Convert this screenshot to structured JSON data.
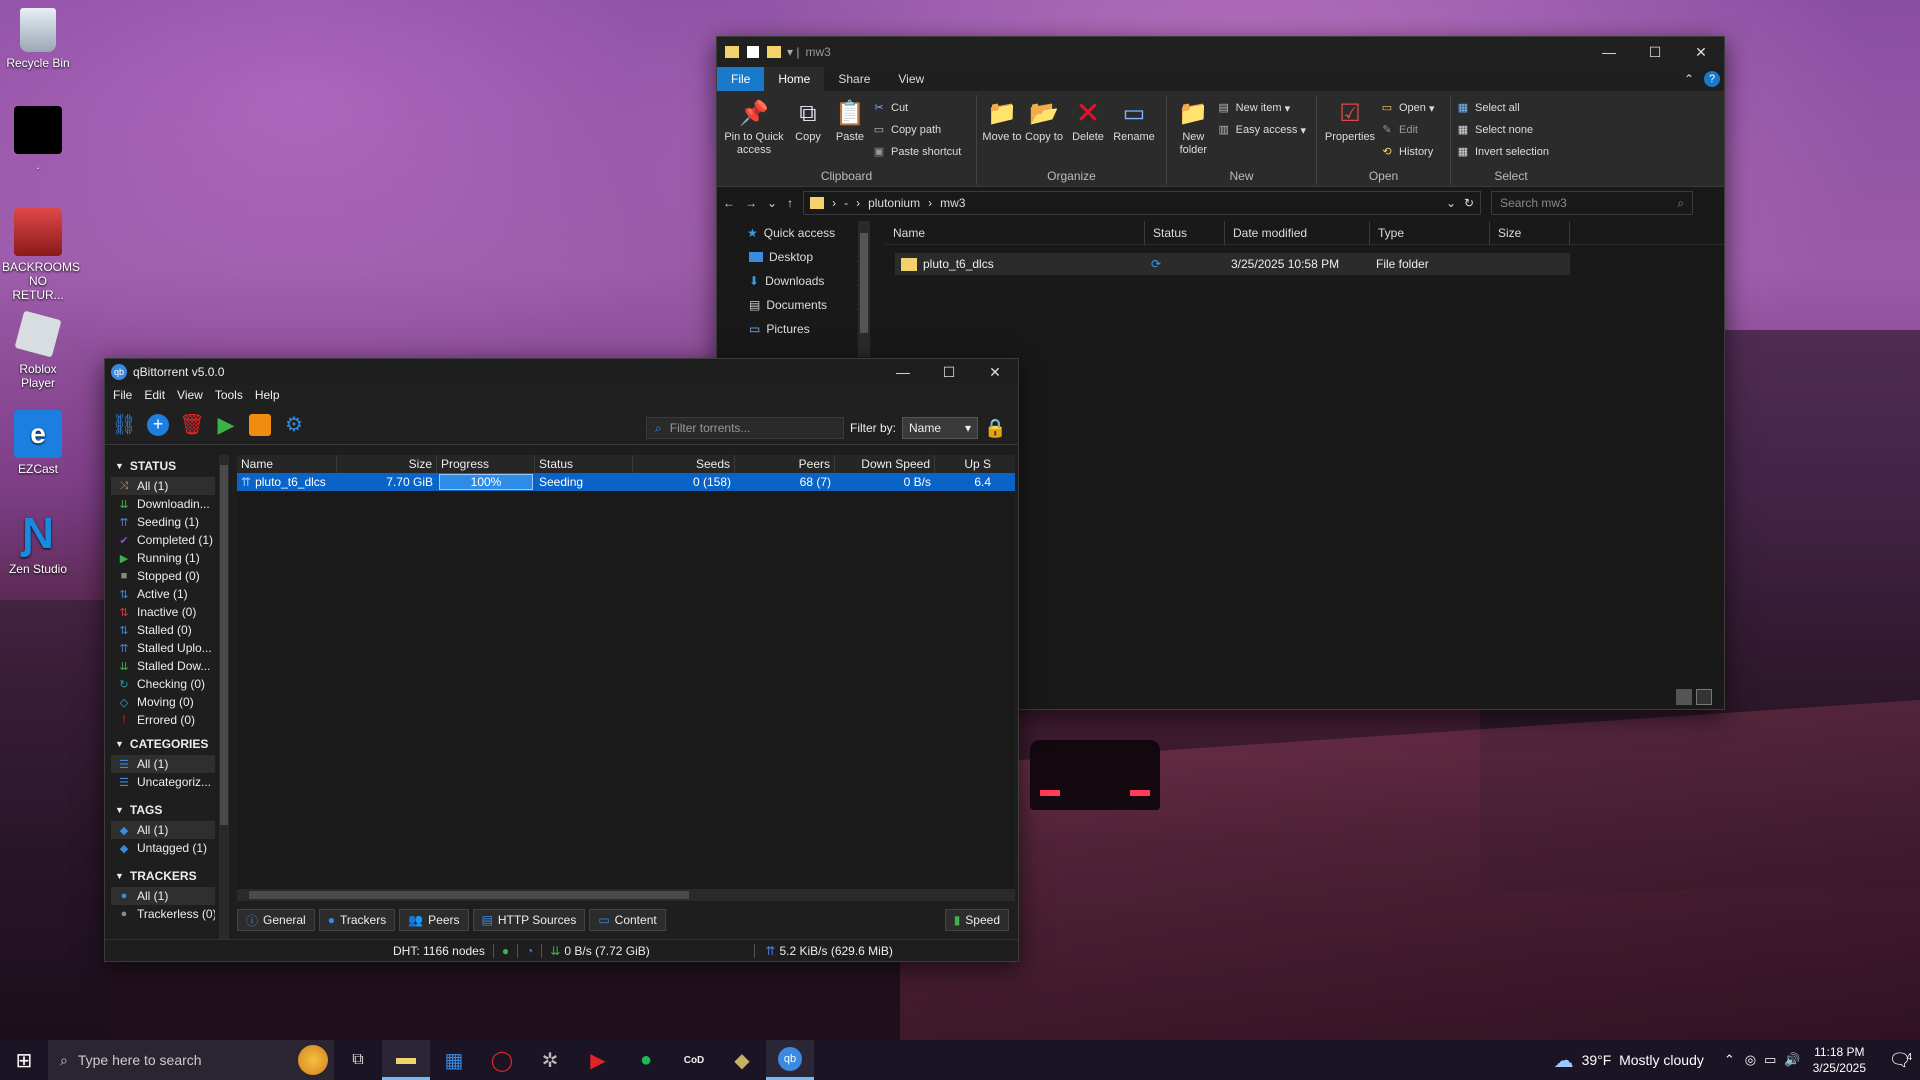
{
  "desktop": {
    "icons": [
      {
        "label": "Recycle Bin"
      },
      {
        "label": "."
      },
      {
        "label": "BACKROOMS NO RETUR..."
      },
      {
        "label": "Roblox Player"
      },
      {
        "label": "EZCast"
      },
      {
        "label": "Zen Studio"
      }
    ]
  },
  "explorer": {
    "title": "mw3",
    "tabs": {
      "file": "File",
      "home": "Home",
      "share": "Share",
      "view": "View"
    },
    "clipboard": {
      "pin": "Pin to Quick access",
      "copy": "Copy",
      "paste": "Paste",
      "cut": "Cut",
      "copy_path": "Copy path",
      "paste_shortcut": "Paste shortcut",
      "label": "Clipboard"
    },
    "organize": {
      "move": "Move to",
      "copy": "Copy to",
      "delete": "Delete",
      "rename": "Rename",
      "label": "Organize"
    },
    "new": {
      "folder": "New folder",
      "item": "New item",
      "easy": "Easy access",
      "label": "New"
    },
    "open": {
      "properties": "Properties",
      "open": "Open",
      "edit": "Edit",
      "history": "History",
      "label": "Open"
    },
    "select": {
      "all": "Select all",
      "none": "Select none",
      "invert": "Invert selection",
      "label": "Select"
    },
    "path": [
      "plutonium",
      "mw3"
    ],
    "search_placeholder": "Search mw3",
    "nav": [
      "Quick access",
      "Desktop",
      "Downloads",
      "Documents",
      "Pictures"
    ],
    "columns": [
      "Name",
      "Status",
      "Date modified",
      "Type",
      "Size"
    ],
    "rows": [
      {
        "name": "pluto_t6_dlcs",
        "date": "3/25/2025 10:58 PM",
        "type": "File folder"
      }
    ]
  },
  "qbt": {
    "title": "qBittorrent v5.0.0",
    "menu": [
      "File",
      "Edit",
      "View",
      "Tools",
      "Help"
    ],
    "filter_placeholder": "Filter torrents...",
    "filter_by": "Filter by:",
    "filter_value": "Name",
    "status_header": "STATUS",
    "status": [
      {
        "label": "All (1)",
        "icon": "⤨",
        "color": "#d08a3a"
      },
      {
        "label": "Downloadin...",
        "icon": "⇊",
        "color": "#3cb34a"
      },
      {
        "label": "Seeding (1)",
        "icon": "⇈",
        "color": "#4a7fd6"
      },
      {
        "label": "Completed (1)",
        "icon": "✔",
        "color": "#8a4fd6"
      },
      {
        "label": "Running (1)",
        "icon": "▶",
        "color": "#3cb34a"
      },
      {
        "label": "Stopped (0)",
        "icon": "■",
        "color": "#888888"
      },
      {
        "label": "Active (1)",
        "icon": "⇅",
        "color": "#3c8ad6"
      },
      {
        "label": "Inactive (0)",
        "icon": "⇅",
        "color": "#d63c3c"
      },
      {
        "label": "Stalled (0)",
        "icon": "⇅",
        "color": "#3c8ad6"
      },
      {
        "label": "Stalled Uplo...",
        "icon": "⇈",
        "color": "#4a7fd6"
      },
      {
        "label": "Stalled Dow...",
        "icon": "⇊",
        "color": "#3cb34a"
      },
      {
        "label": "Checking (0)",
        "icon": "↻",
        "color": "#1fa39a"
      },
      {
        "label": "Moving (0)",
        "icon": "◇",
        "color": "#4a9ad6"
      },
      {
        "label": "Errored (0)",
        "icon": "!",
        "color": "#e0242a"
      }
    ],
    "categories_header": "CATEGORIES",
    "categories": [
      "All (1)",
      "Uncategoriz..."
    ],
    "tags_header": "TAGS",
    "tags": [
      "All (1)",
      "Untagged (1)"
    ],
    "trackers_header": "TRACKERS",
    "trackers": [
      "All (1)",
      "Trackerless (0)"
    ],
    "columns": [
      "Name",
      "Size",
      "Progress",
      "Status",
      "Seeds",
      "Peers",
      "Down Speed",
      "Up S"
    ],
    "torrent": {
      "name": "pluto_t6_dlcs",
      "size": "7.70 GiB",
      "progress": "100%",
      "progress_value": 1.0,
      "status": "Seeding",
      "seeds": "0 (158)",
      "peers": "68 (7)",
      "down": "0 B/s",
      "up": "6.4"
    },
    "bottom_tabs": [
      "General",
      "Trackers",
      "Peers",
      "HTTP Sources",
      "Content"
    ],
    "speed_tab": "Speed",
    "statusbar": {
      "dht": "DHT: 1166 nodes",
      "down": "0 B/s (7.72 GiB)",
      "up": "5.2 KiB/s (629.6 MiB)"
    }
  },
  "taskbar": {
    "search_placeholder": "Type here to search",
    "weather": "39°F  Mostly cloudy",
    "time": "11:18 PM",
    "date": "3/25/2025",
    "notif": "4"
  }
}
